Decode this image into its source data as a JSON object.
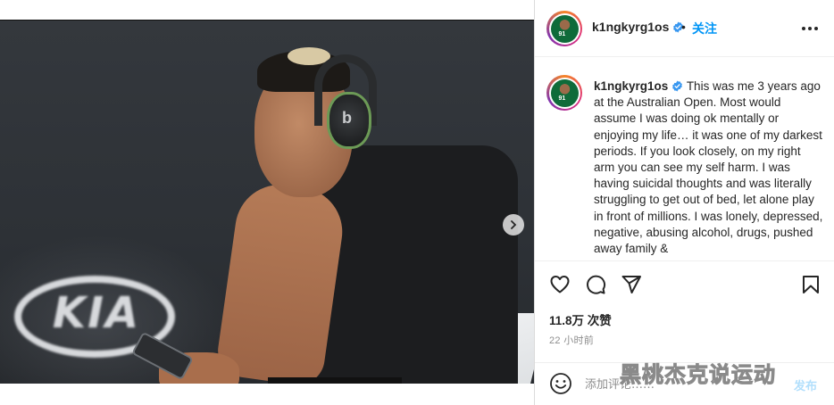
{
  "header": {
    "username": "k1ngkyrg1os",
    "separator": "•",
    "follow_label": "关注",
    "more_icon": "more-horizontal-icon",
    "avatar_text": "91"
  },
  "caption": {
    "username": "k1ngkyrg1os",
    "text": "This was me 3 years ago at the Australian Open. Most would assume I was doing ok mentally or enjoying my life… it was one of my darkest periods. If you look closely, on my right arm you can see my self harm. I was having suicidal thoughts and was literally struggling to get out of bed, let alone play in front of millions. I was lonely, depressed, negative, abusing alcohol, drugs, pushed away family &"
  },
  "photo": {
    "sign_text": "KIA",
    "headphone_logo": "b",
    "carousel_next_icon": "chevron-right-icon",
    "dots_total": 2,
    "dots_active": 0
  },
  "actions": {
    "like_icon": "heart-icon",
    "comment_icon": "comment-icon",
    "share_icon": "paper-plane-icon",
    "save_icon": "bookmark-icon",
    "likes_text": "11.8万 次赞",
    "time_text": "22 小时前"
  },
  "comment_box": {
    "emoji_icon": "smiley-icon",
    "placeholder": "添加评论……",
    "post_label": "发布"
  },
  "watermark": "黑桃杰克说运动",
  "colors": {
    "accent": "#0095f6",
    "verified": "#3897f0",
    "text": "#262626",
    "muted": "#8e8e8e",
    "post_disabled": "#b2dffc"
  }
}
